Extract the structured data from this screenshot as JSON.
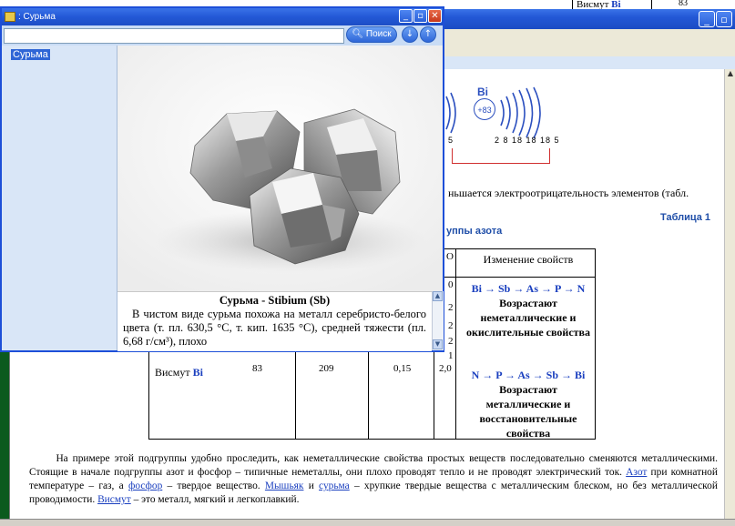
{
  "front_window": {
    "title": ": Сурьма",
    "search_button": "Поиск",
    "sidebar_item": "Сурьма",
    "caption_title": "Сурьма - Stibium (Sb)",
    "caption_text": "В чистом виде сурьма похожа на металл серебристо-белого цвета (т. пл. 630,5 °C, т. кип. 1635 °C), средней тяжести (пл. 6,68 г/см³), плохо"
  },
  "background": {
    "top_cell_text": "Висмут",
    "top_cell_symbol": "Bi",
    "top_num": "83",
    "atom_symbol": "Bi",
    "atom_nucleus": "+83",
    "shell_numbers": "2  8  18 18  18  5",
    "shell_left_num": "5",
    "text_electroneg": "ньшается электроотрицательность элементов (табл.",
    "table_caption": "Таблица 1",
    "group_title": "уппы азота",
    "col_o": "О",
    "col_change": "Изменение свойств",
    "nums_col": [
      "0",
      "2",
      "2",
      "2",
      "1"
    ],
    "row_bismuth_name": "Висмут",
    "row_bismuth_symbol": "Bi",
    "row_bismuth_z": "83",
    "row_bismuth_mass": "209",
    "row_bismuth_radius": "0,15",
    "row_bismuth_eo": "2,0",
    "chain_down": "Bi → Sb → As → P → N",
    "prop_down": "Возрастают неметаллические и окислительные свойства",
    "chain_up": "N → P → As → Sb → Bi",
    "prop_up": "Возрастают металлические и восстановительные свойства",
    "para_1": "На примере этой подгруппы удобно проследить, как неметаллические свойства простых веществ последовательно сменяются металлическими. Стоящие в начале подгруппы азот и фосфор – типичные неметаллы, они плохо проводят тепло и не проводят электрический ток.",
    "link_azot": "Азот",
    "para_2": "при комнатной температуре – газ, а",
    "link_fosfor": "фосфор",
    "para_3": "– твердое вещество.",
    "link_arsenic": "Мышьяк",
    "para_4": "и",
    "link_antimony": "сурьма",
    "para_5": "– хрупкие твердые вещества с металлическим блеском, но без металлической проводимости.",
    "link_bismuth": "Висмут",
    "para_6": "– это металл, мягкий и легкоплавкий."
  },
  "icons": {
    "app": "app-icon",
    "search": "search-icon",
    "back": "back-arrow-icon",
    "forward": "forward-arrow-icon",
    "minimize": "minimize-icon",
    "maximize": "maximize-icon",
    "close": "close-icon",
    "scroll_up": "scroll-up-icon",
    "scroll_down": "scroll-down-icon"
  },
  "colors": {
    "titlebar": "#2358d6",
    "link": "#1a3fbf",
    "desktop": "#0b5a1e",
    "close_button": "#c7381c"
  }
}
